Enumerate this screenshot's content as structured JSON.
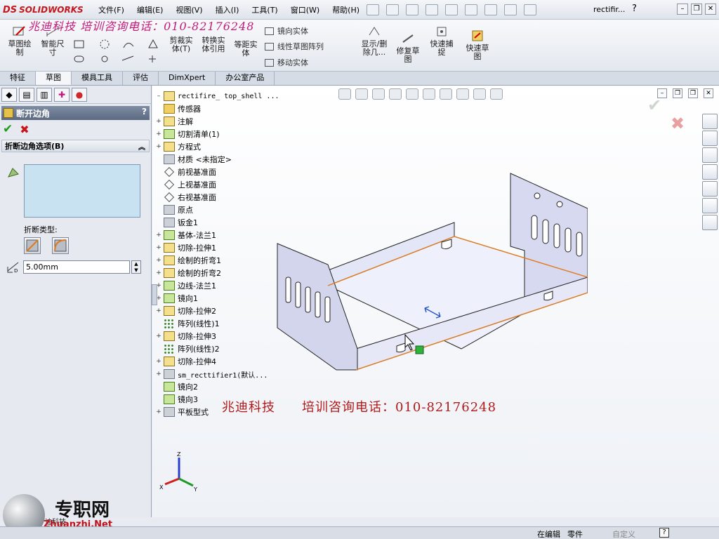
{
  "app": {
    "brand": "SOLIDWORKS",
    "brand_mark": "DS",
    "doc_title": "rectifir...",
    "help_label": "?",
    "win_min": "–",
    "win_restore": "❐",
    "win_close": "✕"
  },
  "menu": [
    "文件(F)",
    "编辑(E)",
    "视图(V)",
    "插入(I)",
    "工具(T)",
    "窗口(W)",
    "帮助(H)"
  ],
  "watermark": {
    "top_banner": "兆迪科技  培训咨询电话：010-82176248",
    "company": "兆迪科技",
    "phone": "培训咨询电话：010-82176248",
    "brand": "专职网",
    "site": "Zhuanzhi.Net",
    "company_small": "迪科技"
  },
  "commands": {
    "sketch": "草图绘\n制",
    "smart_dim": "智能尺\n寸",
    "trim": "剪裁实\n体(T)",
    "convert": "转换实\n体引用",
    "offset": "等距实\n体",
    "mirror": "镜向实体",
    "linear_pattern": "线性草图阵列",
    "move": "移动实体",
    "show_delete": "显示/删\n除几...",
    "repair": "修复草\n图",
    "quick_snap": "快速捕\n捉",
    "rapid_sketch": "快速草\n图"
  },
  "tabs": [
    "特征",
    "草图",
    "模具工具",
    "评估",
    "DimXpert",
    "办公室产品"
  ],
  "active_tab": "草图",
  "property_manager": {
    "title": "断开边角",
    "help": "?",
    "ok": "✔",
    "cancel": "✖",
    "group_title": "折断边角选项(B)",
    "collapse": "︽",
    "break_type_label": "折断类型:",
    "distance_value": "5.00mm",
    "spin": "▲\n▼"
  },
  "tree": {
    "root": "rectifire_ top_shell  ...",
    "items": [
      {
        "label": "传感器",
        "expander": "",
        "icon": "folder"
      },
      {
        "label": "注解",
        "expander": "+",
        "icon": "yellow"
      },
      {
        "label": "切割清单(1)",
        "expander": "+",
        "icon": "green"
      },
      {
        "label": "方程式",
        "expander": "+",
        "icon": "yellow"
      },
      {
        "label": "材质 <未指定>",
        "expander": "",
        "icon": "grey"
      },
      {
        "label": "前视基准面",
        "expander": "",
        "icon": "plane"
      },
      {
        "label": "上视基准面",
        "expander": "",
        "icon": "plane"
      },
      {
        "label": "右视基准面",
        "expander": "",
        "icon": "plane"
      },
      {
        "label": "原点",
        "expander": "",
        "icon": "grey"
      },
      {
        "label": "钣金1",
        "expander": "",
        "icon": "grey"
      },
      {
        "label": "基体-法兰1",
        "expander": "+",
        "icon": "green"
      },
      {
        "label": "切除-拉伸1",
        "expander": "+",
        "icon": "yellow"
      },
      {
        "label": "绘制的折弯1",
        "expander": "+",
        "icon": "yellow"
      },
      {
        "label": "绘制的折弯2",
        "expander": "+",
        "icon": "yellow"
      },
      {
        "label": "边线-法兰1",
        "expander": "+",
        "icon": "green"
      },
      {
        "label": "镜向1",
        "expander": "+",
        "icon": "green"
      },
      {
        "label": "切除-拉伸2",
        "expander": "+",
        "icon": "yellow"
      },
      {
        "label": "阵列(线性)1",
        "expander": "",
        "icon": "dots"
      },
      {
        "label": "切除-拉伸3",
        "expander": "+",
        "icon": "yellow"
      },
      {
        "label": "阵列(线性)2",
        "expander": "",
        "icon": "dots"
      },
      {
        "label": "切除-拉伸4",
        "expander": "+",
        "icon": "yellow"
      },
      {
        "label": "sm_recttifier1(默认...",
        "expander": "+",
        "icon": "grey"
      },
      {
        "label": "镜向2",
        "expander": "",
        "icon": "green"
      },
      {
        "label": "镜向3",
        "expander": "",
        "icon": "green"
      },
      {
        "label": "平板型式",
        "expander": "+",
        "icon": "grey"
      }
    ]
  },
  "triad": {
    "x": "X",
    "y": "Y",
    "z": "Z"
  },
  "status": {
    "mode": "在编辑",
    "doc_type": "零件",
    "custom": "自定义",
    "help": "?"
  },
  "colors": {
    "accent": "#c4161c",
    "part_fill": "#d8dbf0",
    "edge_highlight": "#e07a1c",
    "selection_box": "#c8e2f2"
  }
}
